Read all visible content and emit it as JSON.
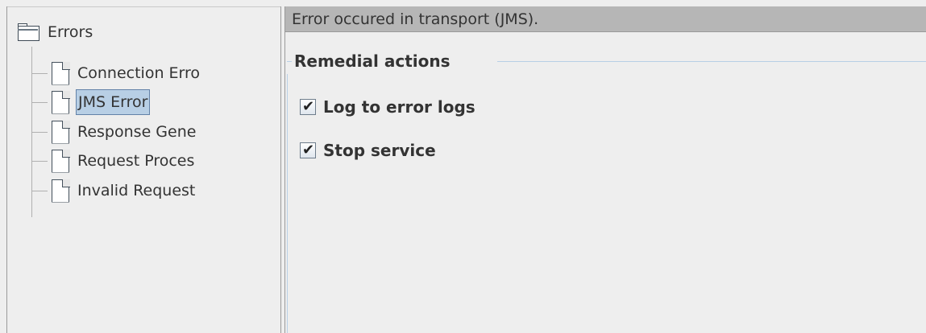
{
  "tree": {
    "root": {
      "label": "Errors",
      "icon": "folder-icon"
    },
    "items": [
      {
        "label": "Connection Erro",
        "icon": "document-icon",
        "selected": false
      },
      {
        "label": "JMS Error",
        "icon": "document-icon",
        "selected": true
      },
      {
        "label": "Response Gene",
        "icon": "document-icon",
        "selected": false
      },
      {
        "label": "Request Proces",
        "icon": "document-icon",
        "selected": false
      },
      {
        "label": "Invalid Request",
        "icon": "document-icon",
        "selected": false
      }
    ]
  },
  "detail": {
    "header": "Error occured in transport (JMS).",
    "group_title": "Remedial actions",
    "actions": [
      {
        "label": "Log to error logs",
        "checked": true
      },
      {
        "label": "Stop service",
        "checked": true
      }
    ]
  },
  "colors": {
    "header_bg": "#b6b6b6",
    "selection_bg": "#b8cfe5",
    "selection_border": "#6382a8",
    "panel_bg": "#eeeeee"
  }
}
